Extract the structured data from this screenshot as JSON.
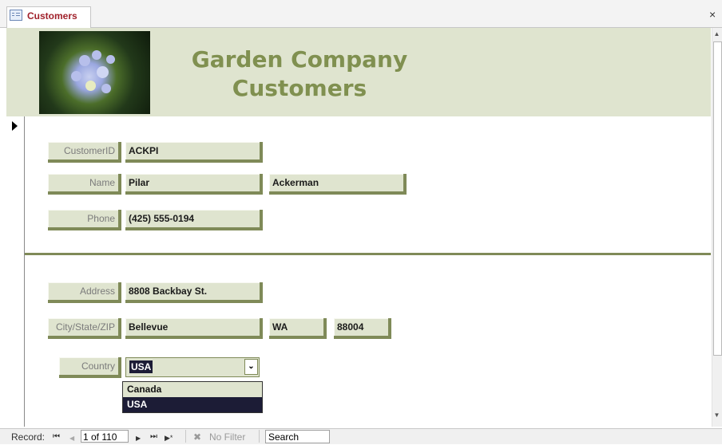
{
  "tab": {
    "title": "Customers",
    "icon": "form-icon"
  },
  "window": {
    "close": "×"
  },
  "header": {
    "title_line1": "Garden Company",
    "title_line2": "Customers",
    "image": "hydrangea-photo"
  },
  "fields": {
    "customer_id": {
      "label": "CustomerID",
      "value": "ACKPI"
    },
    "name": {
      "label": "Name",
      "first": "Pilar",
      "last": "Ackerman"
    },
    "phone": {
      "label": "Phone",
      "value": "(425) 555-0194"
    },
    "address": {
      "label": "Address",
      "value": "8808 Backbay St."
    },
    "city_state_zip": {
      "label": "City/State/ZIP",
      "city": "Bellevue",
      "state": "WA",
      "zip": "88004"
    },
    "country": {
      "label": "Country",
      "value": "USA",
      "options": [
        "Canada",
        "USA"
      ]
    }
  },
  "navigation": {
    "record_label": "Record:",
    "record_position": "1 of 110",
    "first": "⏮",
    "prev": "◀",
    "next": "▶",
    "last": "⏭",
    "new": "▶*",
    "filter_label": "No Filter",
    "search_label": "Search"
  },
  "scrollbar": {
    "up": "▲",
    "down": "▼"
  },
  "colors": {
    "accent": "#809050",
    "band": "#dfe4cf",
    "selected": "#1c1c36",
    "tab_text": "#a0212b"
  }
}
